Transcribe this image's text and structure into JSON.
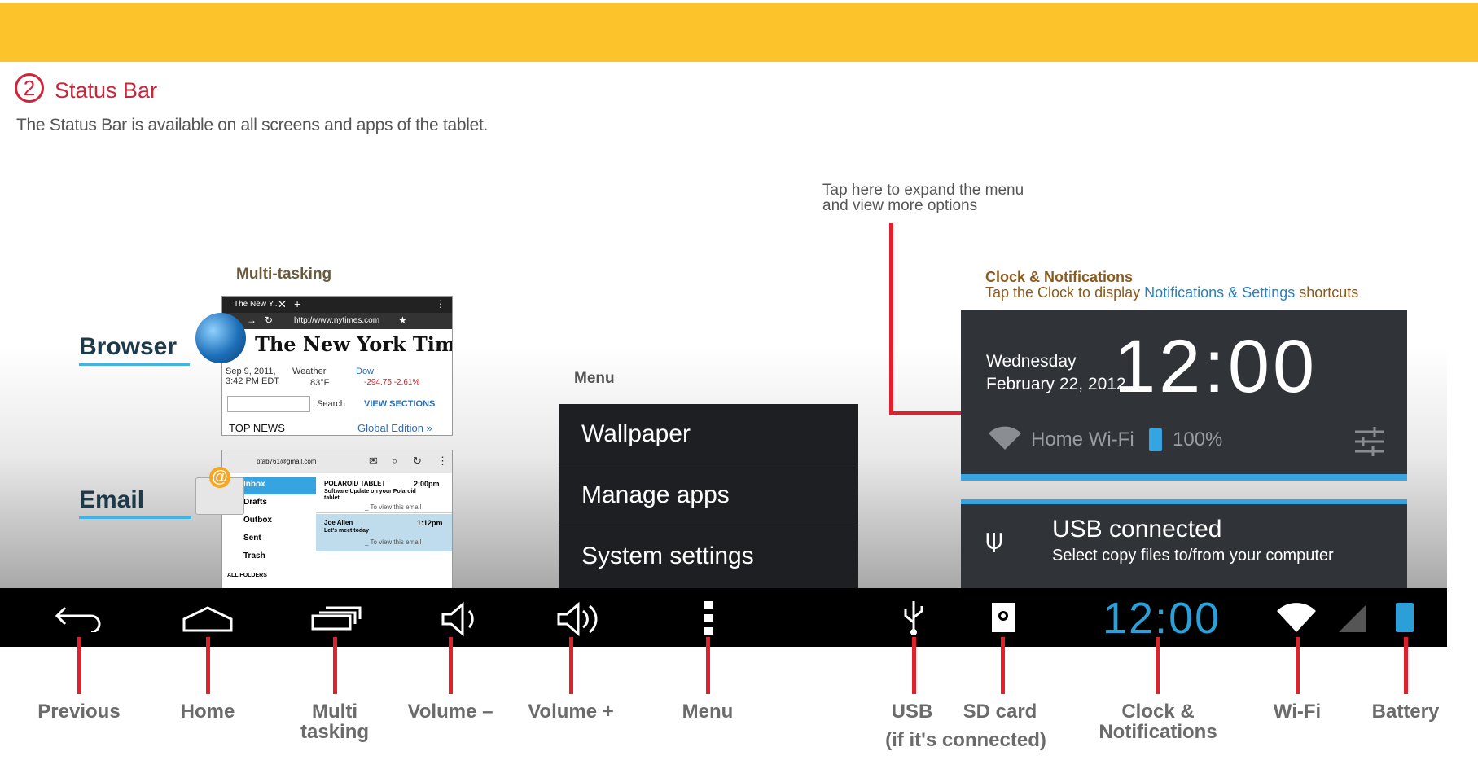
{
  "header": {
    "section_number": "2",
    "section_title": "Status Bar",
    "description": "The Status Bar is available on all screens and apps of the tablet."
  },
  "multitask": {
    "heading": "Multi-tasking",
    "browser_label": "Browser",
    "email_label": "Email",
    "browser_shot": {
      "tab": "The New Y..",
      "url": "http://www.nytimes.com",
      "masthead": "The New York Times",
      "date": "Sep 9, 2011,",
      "time": "3:42 PM EDT",
      "weather_label": "Weather",
      "weather_value": "83°F",
      "dow_label": "Dow",
      "dow_value": "-294.75 -2.61%",
      "search_btn": "Search",
      "sections": "VIEW SECTIONS",
      "top_news": "TOP NEWS",
      "edition": "Global Edition »"
    },
    "email_shot": {
      "account": "ptab761@gmail.com",
      "folders": [
        "Inbox",
        "Drafts",
        "Outbox",
        "Sent",
        "Trash",
        "ALL FOLDERS"
      ],
      "msg1_from": "POLAROID TABLET",
      "msg1_time": "2:00pm",
      "msg1_subject": "Software Update on your Polaroid tablet",
      "msg1_preview": "_ To view this email",
      "msg2_from": "Joe Allen",
      "msg2_time": "1:12pm",
      "msg2_subject": "Let's meet today",
      "msg2_preview": "_ To view this email"
    }
  },
  "menu": {
    "heading": "Menu",
    "items": [
      "Wallpaper",
      "Manage apps",
      "System settings"
    ]
  },
  "tap_note": {
    "line1": "Tap here to expand the menu",
    "line2": "and view more options"
  },
  "clock_panel": {
    "heading": "Clock & Notifications",
    "sub_part1": "Tap the Clock to display ",
    "sub_part2": "Notifications &",
    "sub_part3": "Settings",
    "sub_part4": " shortcuts",
    "day": "Wednesday",
    "date": "February 22, 2012",
    "time": "12:00",
    "wifi_name": "Home Wi-Fi",
    "battery": "100%",
    "usb_title": "USB connected",
    "usb_desc": "Select copy files to/from your computer"
  },
  "statusbar": {
    "time": "12:00",
    "accent": "#2a9fd8"
  },
  "labels": {
    "previous": "Previous",
    "home": "Home",
    "multi1": "Multi",
    "multi2": "tasking",
    "vol_down": "Volume –",
    "vol_up": "Volume +",
    "menu": "Menu",
    "usb": "USB",
    "sd": "SD card",
    "connected_note": "(if it's connected)",
    "clock1": "Clock &",
    "clock2": "Notifications",
    "wifi": "Wi-Fi",
    "battery": "Battery"
  }
}
